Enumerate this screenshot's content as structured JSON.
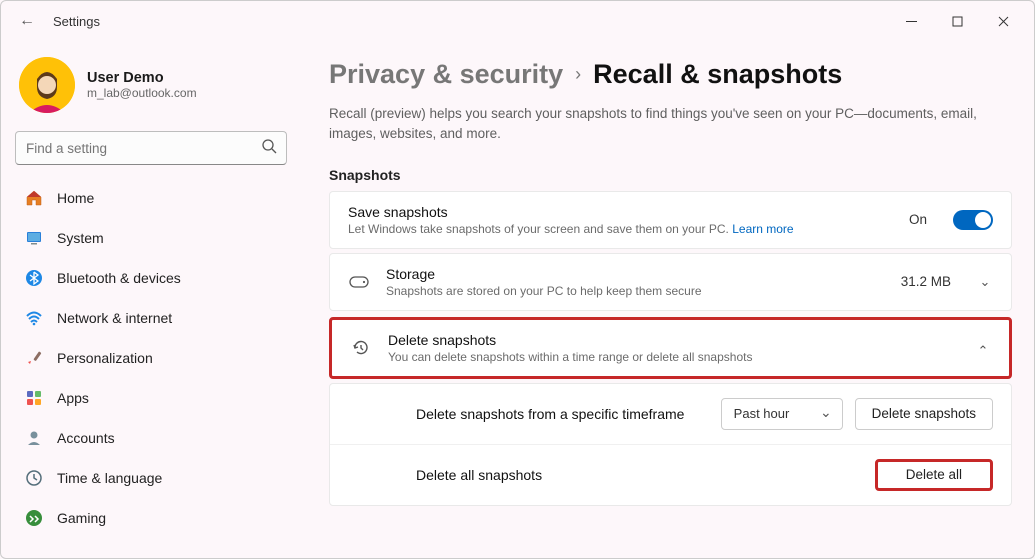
{
  "app_title": "Settings",
  "user": {
    "name": "User Demo",
    "email": "m_lab@outlook.com"
  },
  "search_placeholder": "Find a setting",
  "nav": [
    {
      "icon": "home",
      "label": "Home"
    },
    {
      "icon": "system",
      "label": "System"
    },
    {
      "icon": "bluetooth",
      "label": "Bluetooth & devices"
    },
    {
      "icon": "network",
      "label": "Network & internet"
    },
    {
      "icon": "personalization",
      "label": "Personalization"
    },
    {
      "icon": "apps",
      "label": "Apps"
    },
    {
      "icon": "accounts",
      "label": "Accounts"
    },
    {
      "icon": "time",
      "label": "Time & language"
    },
    {
      "icon": "gaming",
      "label": "Gaming"
    }
  ],
  "breadcrumb": {
    "parent": "Privacy & security",
    "current": "Recall & snapshots"
  },
  "page_description": "Recall (preview) helps you search your snapshots to find things you've seen on your PC—documents, email, images, websites, and more.",
  "section_title": "Snapshots",
  "save_snapshots": {
    "title": "Save snapshots",
    "sub": "Let Windows take snapshots of your screen and save them on your PC.",
    "learn_more": "Learn more",
    "state_label": "On"
  },
  "storage": {
    "title": "Storage",
    "sub": "Snapshots are stored on your PC to help keep them secure",
    "value": "31.2 MB"
  },
  "delete_snapshots": {
    "title": "Delete snapshots",
    "sub": "You can delete snapshots within a time range or delete all snapshots",
    "timeframe_label": "Delete snapshots from a specific timeframe",
    "timeframe_value": "Past hour",
    "delete_btn": "Delete snapshots",
    "delete_all_label": "Delete all snapshots",
    "delete_all_btn": "Delete all"
  }
}
